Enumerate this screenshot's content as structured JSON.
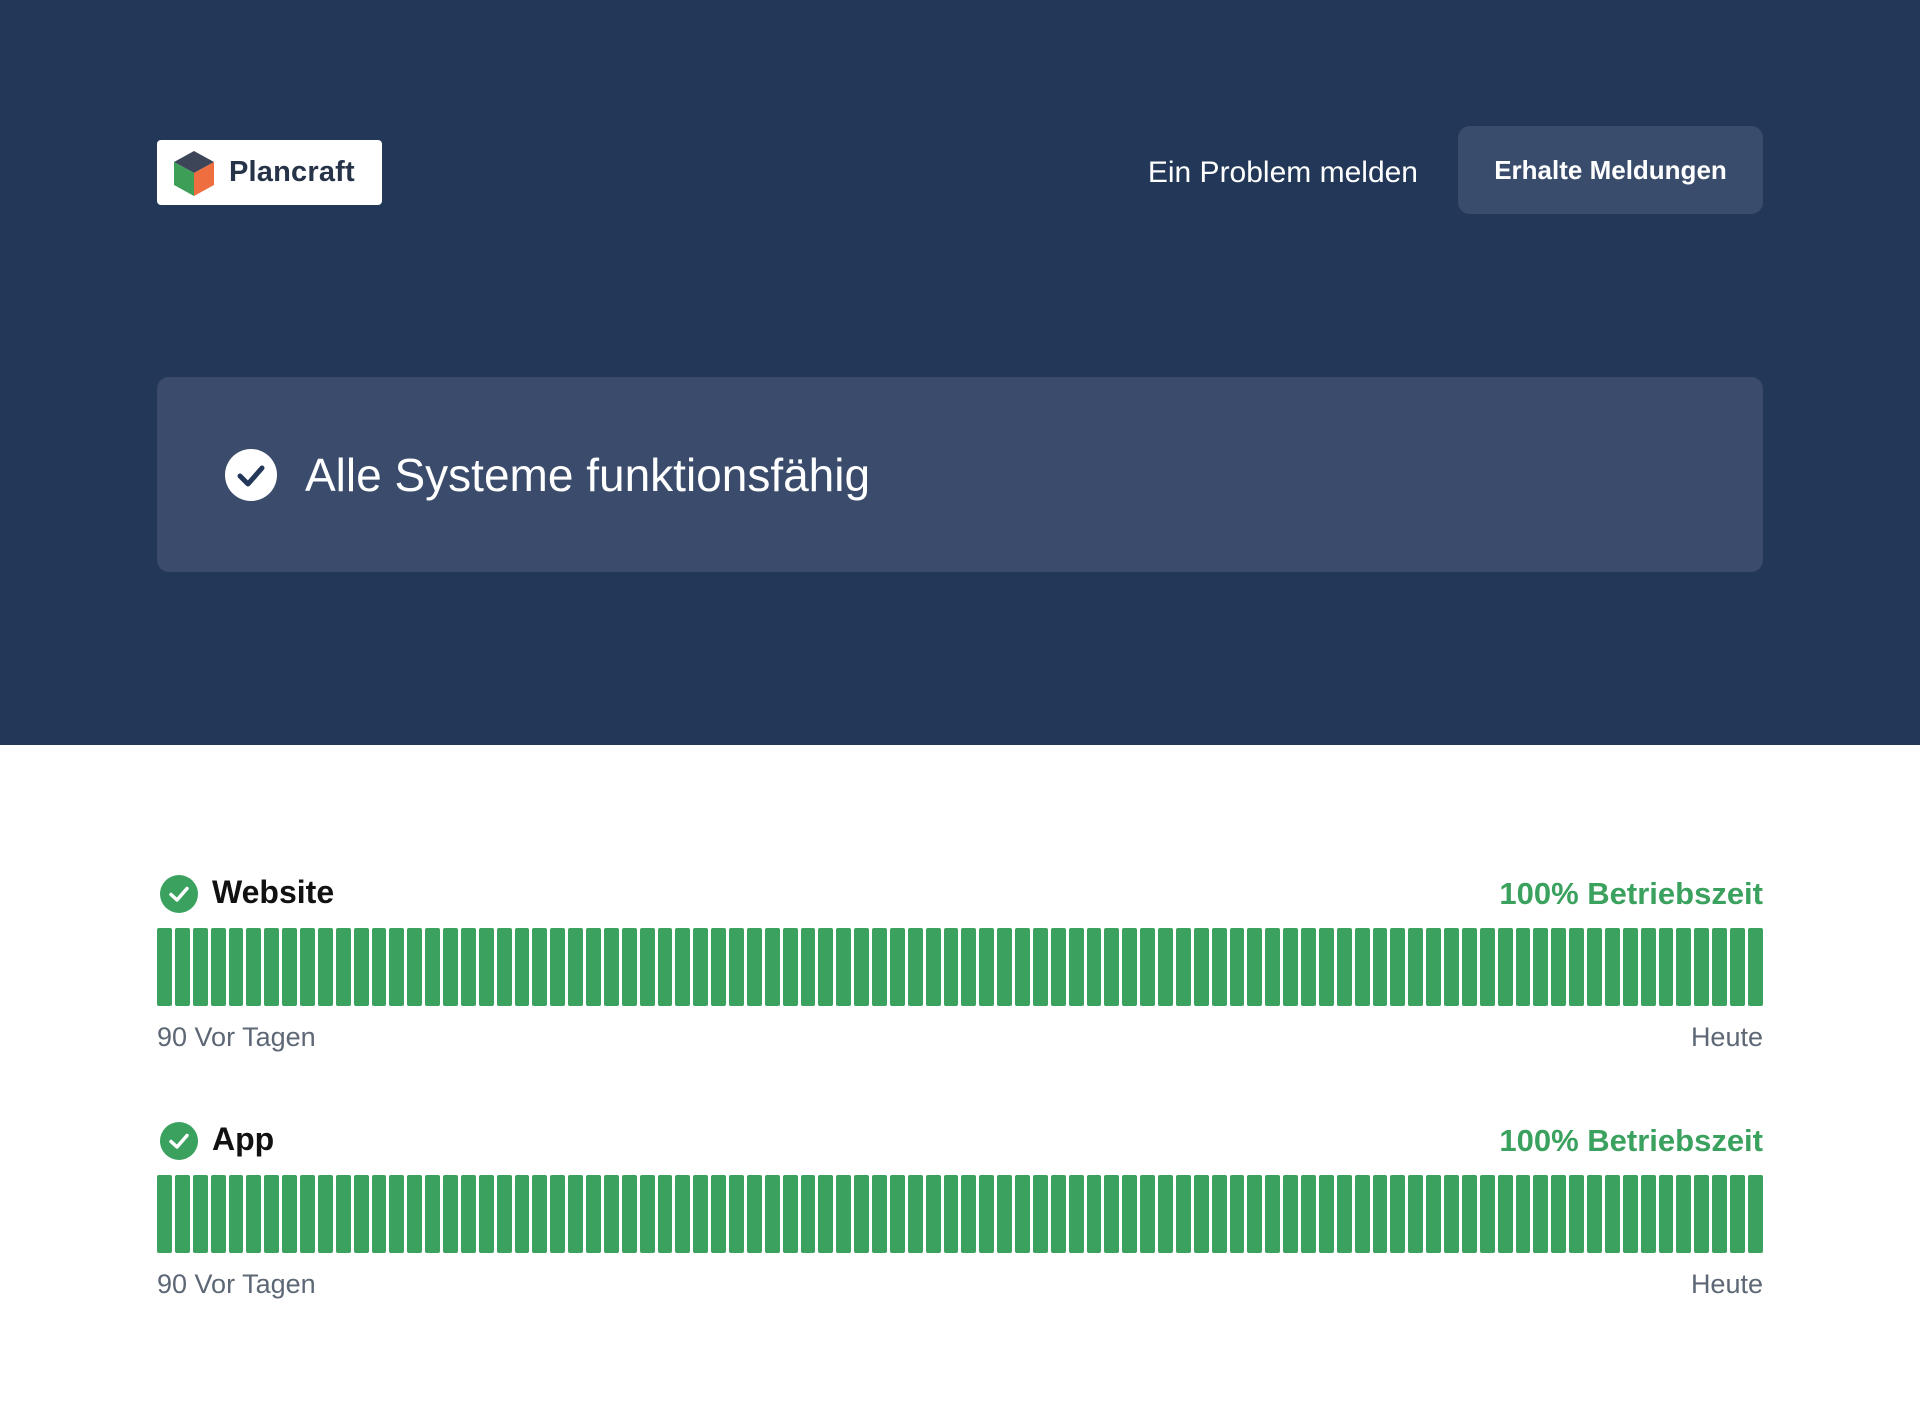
{
  "header": {
    "brand_name": "Plancraft",
    "report_problem_link": "Ein Problem melden",
    "subscribe_button": "Erhalte Meldungen"
  },
  "status": {
    "title": "Alle Systeme funktionsfähig"
  },
  "components": [
    {
      "name": "Website",
      "uptime": "100% Betriebszeit",
      "start_label": "90 Vor Tagen",
      "end_label": "Heute",
      "days": 90
    },
    {
      "name": "App",
      "uptime": "100% Betriebszeit",
      "start_label": "90 Vor Tagen",
      "end_label": "Heute",
      "days": 90
    }
  ],
  "colors": {
    "header_background": "#233858",
    "banner_background": "#3a4b6b",
    "operational_green": "#3aa15e"
  },
  "icons": {
    "logo": "cube-logo-icon",
    "status": "check-circle-icon",
    "component": "check-circle-icon"
  }
}
